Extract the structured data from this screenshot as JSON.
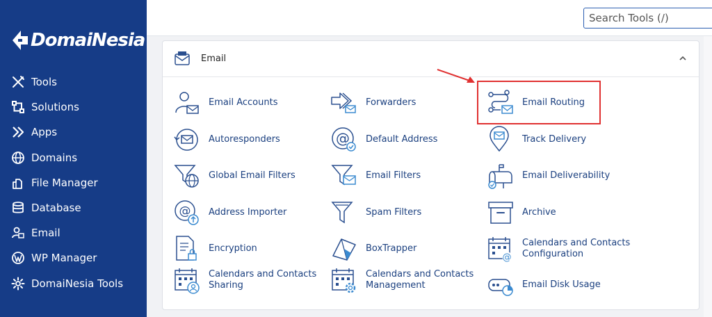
{
  "brand": {
    "name": "DomaiNesia"
  },
  "sidebar": {
    "items": [
      {
        "label": "Tools",
        "icon": "tools-icon"
      },
      {
        "label": "Solutions",
        "icon": "solutions-icon"
      },
      {
        "label": "Apps",
        "icon": "apps-icon"
      },
      {
        "label": "Domains",
        "icon": "globe-icon"
      },
      {
        "label": "File Manager",
        "icon": "file-manager-icon"
      },
      {
        "label": "Database",
        "icon": "database-icon"
      },
      {
        "label": "Email",
        "icon": "email-icon"
      },
      {
        "label": "WP Manager",
        "icon": "wordpress-icon"
      },
      {
        "label": "DomaiNesia Tools",
        "icon": "gear-icon"
      }
    ]
  },
  "search": {
    "placeholder": "Search Tools (/)"
  },
  "panel": {
    "title": "Email",
    "tools": [
      {
        "label": "Email Accounts",
        "icon": "email-accounts-icon"
      },
      {
        "label": "Forwarders",
        "icon": "forwarders-icon"
      },
      {
        "label": "Email Routing",
        "icon": "email-routing-icon"
      },
      {
        "label": "Autoresponders",
        "icon": "autoresponders-icon"
      },
      {
        "label": "Default Address",
        "icon": "default-address-icon"
      },
      {
        "label": "Track Delivery",
        "icon": "track-delivery-icon"
      },
      {
        "label": "Global Email Filters",
        "icon": "global-email-filters-icon"
      },
      {
        "label": "Email Filters",
        "icon": "email-filters-icon"
      },
      {
        "label": "Email Deliverability",
        "icon": "email-deliverability-icon"
      },
      {
        "label": "Address Importer",
        "icon": "address-importer-icon"
      },
      {
        "label": "Spam Filters",
        "icon": "spam-filters-icon"
      },
      {
        "label": "Archive",
        "icon": "archive-icon"
      },
      {
        "label": "Encryption",
        "icon": "encryption-icon"
      },
      {
        "label": "BoxTrapper",
        "icon": "boxtrapper-icon"
      },
      {
        "label": "Calendars and Contacts Configuration",
        "line1": "Calendars and Contacts",
        "line2": "Configuration",
        "icon": "calendar-config-icon"
      },
      {
        "label": "Calendars and Contacts Sharing",
        "line1": "Calendars and Contacts",
        "line2": "Sharing",
        "icon": "calendar-sharing-icon"
      },
      {
        "label": "Calendars and Contacts Management",
        "line1": "Calendars and Contacts",
        "line2": "Management",
        "icon": "calendar-management-icon"
      },
      {
        "label": "Email Disk Usage",
        "icon": "disk-usage-icon"
      }
    ]
  },
  "colors": {
    "sidebar": "#163c87",
    "accent": "#1a3f7f",
    "highlight": "#e03030"
  }
}
